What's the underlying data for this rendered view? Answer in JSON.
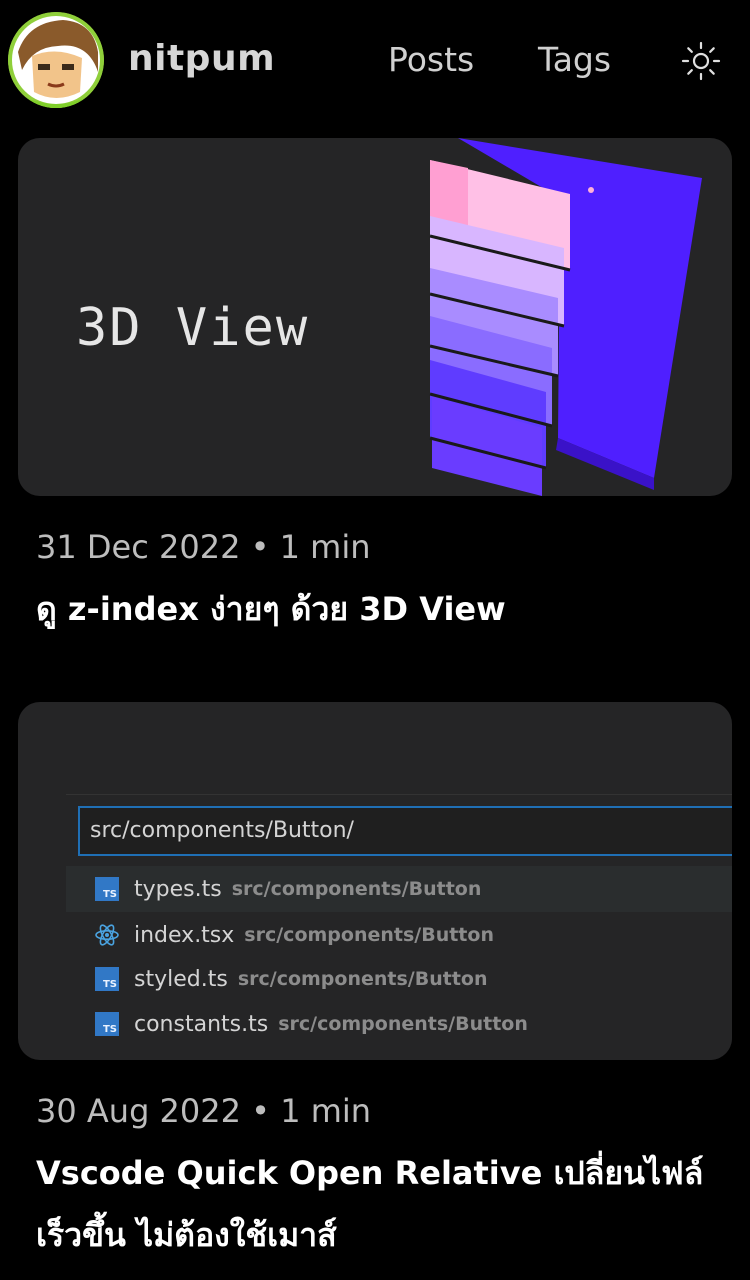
{
  "header": {
    "brand": "nitpum",
    "nav": [
      {
        "label": "Posts"
      },
      {
        "label": "Tags"
      }
    ],
    "theme_icon": "sun-icon"
  },
  "posts": [
    {
      "thumbnail": {
        "text": "3D View",
        "accent": "#5b2cff"
      },
      "date": "31 Dec 2022",
      "separator": "•",
      "read_time": "1 min",
      "title": "ดู z-index ง่ายๆ ด้วย 3D View"
    },
    {
      "thumbnail": {
        "search_value": "src/components/Button/",
        "results": [
          {
            "icon": "typescript-icon",
            "name": "types.ts",
            "path": "src/components/Button"
          },
          {
            "icon": "react-icon",
            "name": "index.tsx",
            "path": "src/components/Button"
          },
          {
            "icon": "typescript-icon",
            "name": "styled.ts",
            "path": "src/components/Button"
          },
          {
            "icon": "typescript-icon",
            "name": "constants.ts",
            "path": "src/components/Button"
          }
        ],
        "ts_label": "TS"
      },
      "date": "30 Aug 2022",
      "separator": "•",
      "read_time": "1 min",
      "title": "Vscode Quick Open Relative เปลี่ยนไฟล์เร็วขึ้น ไม่ต้องใช้เมาส์"
    }
  ],
  "colors": {
    "background": "#000000",
    "card_bg": "#252526",
    "meta_text": "#bdbdbd",
    "vscode_focus": "#1f6fb5"
  }
}
